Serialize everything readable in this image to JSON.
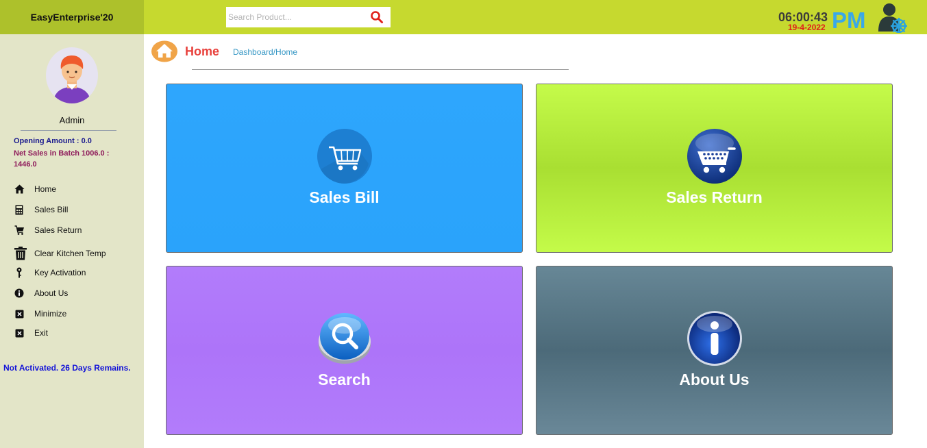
{
  "app": {
    "title": "EasyEnterprise'20"
  },
  "header": {
    "search_placeholder": "Search Product...",
    "time": "06:00:43",
    "ampm": "PM",
    "date": "19-4-2022"
  },
  "sidebar": {
    "user_name": "Admin",
    "opening_amount": "Opening Amount : 0.0",
    "net_sales": "Net Sales in Batch 1006.0 : 1446.0",
    "items": [
      {
        "label": "Home",
        "icon": "home-icon"
      },
      {
        "label": "Sales Bill",
        "icon": "calculator-icon"
      },
      {
        "label": "Sales Return",
        "icon": "cart-icon"
      },
      {
        "label": "Clear Kitchen Temp",
        "icon": "trash-icon"
      },
      {
        "label": "Key Activation",
        "icon": "key-icon"
      },
      {
        "label": "About Us",
        "icon": "info-icon"
      },
      {
        "label": "Minimize",
        "icon": "close-box-icon"
      },
      {
        "label": "Exit",
        "icon": "close-box-icon"
      }
    ],
    "activation_status": "Not Activated. 26 Days Remains."
  },
  "page": {
    "title": "Home",
    "breadcrumb": "Dashboard/Home"
  },
  "tiles": [
    {
      "label": "Sales Bill",
      "icon": "shopping-cart-icon",
      "color": "#2ea6fd"
    },
    {
      "label": "Sales Return",
      "icon": "cart-return-icon",
      "color": "#c5fb4a"
    },
    {
      "label": "Search",
      "icon": "magnifier-icon",
      "color": "#b27cfb"
    },
    {
      "label": "About Us",
      "icon": "info-icon",
      "color": "#5a7888"
    }
  ]
}
